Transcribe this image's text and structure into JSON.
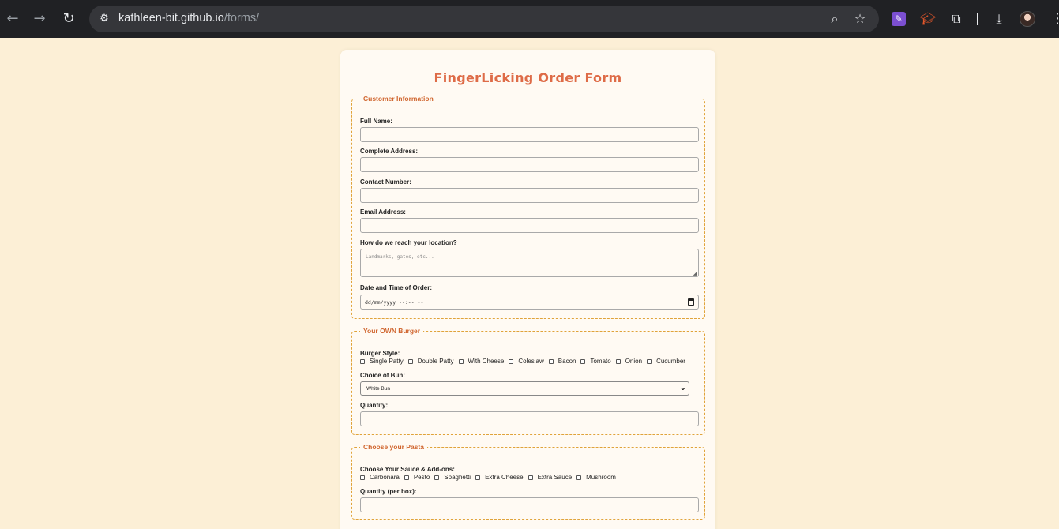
{
  "browser": {
    "url_host": "kathleen-bit.github.io",
    "url_path": "/forms/",
    "icons": {
      "back": "arrow-left-icon",
      "forward": "arrow-right-icon",
      "reload": "reload-icon",
      "site_info": "tune-icon",
      "zoom": "zoom-icon",
      "bookmark": "star-icon",
      "extension_1": "pen-extension-icon",
      "extension_2": "graduation-cap-extension-icon",
      "extensions": "puzzle-icon",
      "downloads": "download-icon",
      "profile": "avatar-icon",
      "menu": "kebab-menu-icon"
    }
  },
  "form": {
    "title": "FingerLicking Order Form",
    "customer": {
      "legend": "Customer Information",
      "full_name_label": "Full Name:",
      "address_label": "Complete Address:",
      "contact_label": "Contact Number:",
      "email_label": "Email Address:",
      "reach_label": "How do we reach your location?",
      "reach_placeholder": "Landmarks, gates, etc...",
      "datetime_label": "Date and Time of Order:",
      "datetime_value": "dd/mm/yyyy --:-- --"
    },
    "burger": {
      "legend": "Your OWN Burger",
      "style_label": "Burger Style:",
      "options": [
        "Single Patty",
        "Double Patty",
        "With Cheese",
        "Coleslaw",
        "Bacon",
        "Tomato",
        "Onion",
        "Cucumber"
      ],
      "bun_label": "Choice of Bun:",
      "bun_value": "White Bun",
      "quantity_label": "Quantity:"
    },
    "pasta": {
      "legend": "Choose your Pasta",
      "sauce_label": "Choose Your Sauce & Add-ons:",
      "options": [
        "Carbonara",
        "Pesto",
        "Spaghetti",
        "Extra Cheese",
        "Extra Sauce",
        "Mushroom"
      ],
      "quantity_label": "Quantity (per box):"
    }
  },
  "colors": {
    "page_bg": "#fcefd6",
    "card_bg": "#fffaf3",
    "title": "#de6b47",
    "legend": "#d0652e",
    "fieldset_border": "#e0a33a"
  }
}
